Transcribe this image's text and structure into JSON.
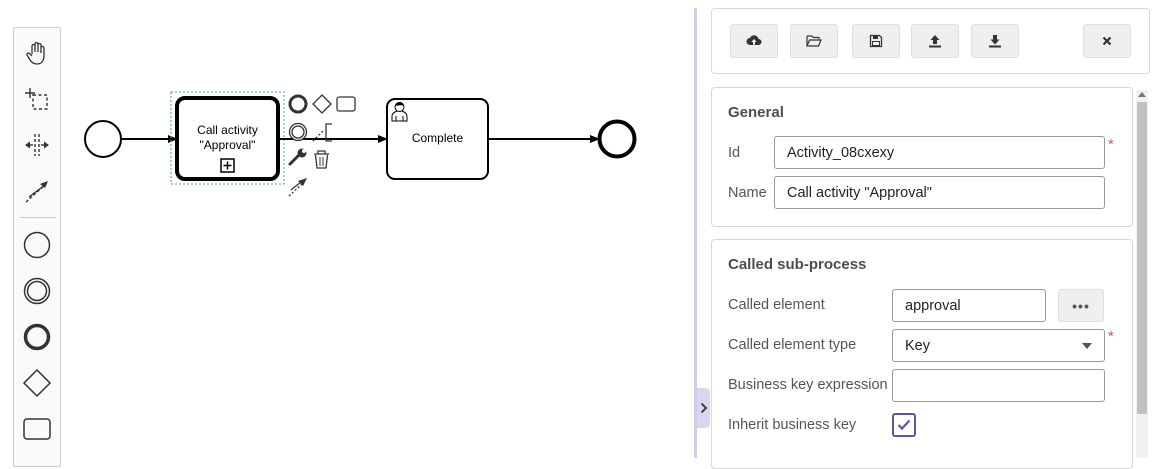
{
  "diagram": {
    "call_activity": {
      "line1": "Call activity",
      "line2": "\"Approval\""
    },
    "user_task": {
      "label": "Complete"
    }
  },
  "toolbar": {
    "buttons": [
      "cloud-upload-icon",
      "folder-open-icon",
      "save-icon",
      "upload-icon",
      "download-icon",
      "close-icon"
    ]
  },
  "general": {
    "title": "General",
    "id_label": "Id",
    "id_value": "Activity_08cxexy",
    "name_label": "Name",
    "name_value": "Call activity \"Approval\""
  },
  "called_sub_process": {
    "title": "Called sub-process",
    "called_element_label": "Called element",
    "called_element_value": "approval",
    "browse_label": "•••",
    "called_element_type_label": "Called element type",
    "called_element_type_value": "Key",
    "business_key_label": "Business key expression",
    "business_key_value": "",
    "inherit_label": "Inherit business key",
    "inherit_checked": true
  },
  "colors": {
    "accent": "#5b57a4",
    "required": "#d9534f",
    "selection": "#4a90d9"
  }
}
